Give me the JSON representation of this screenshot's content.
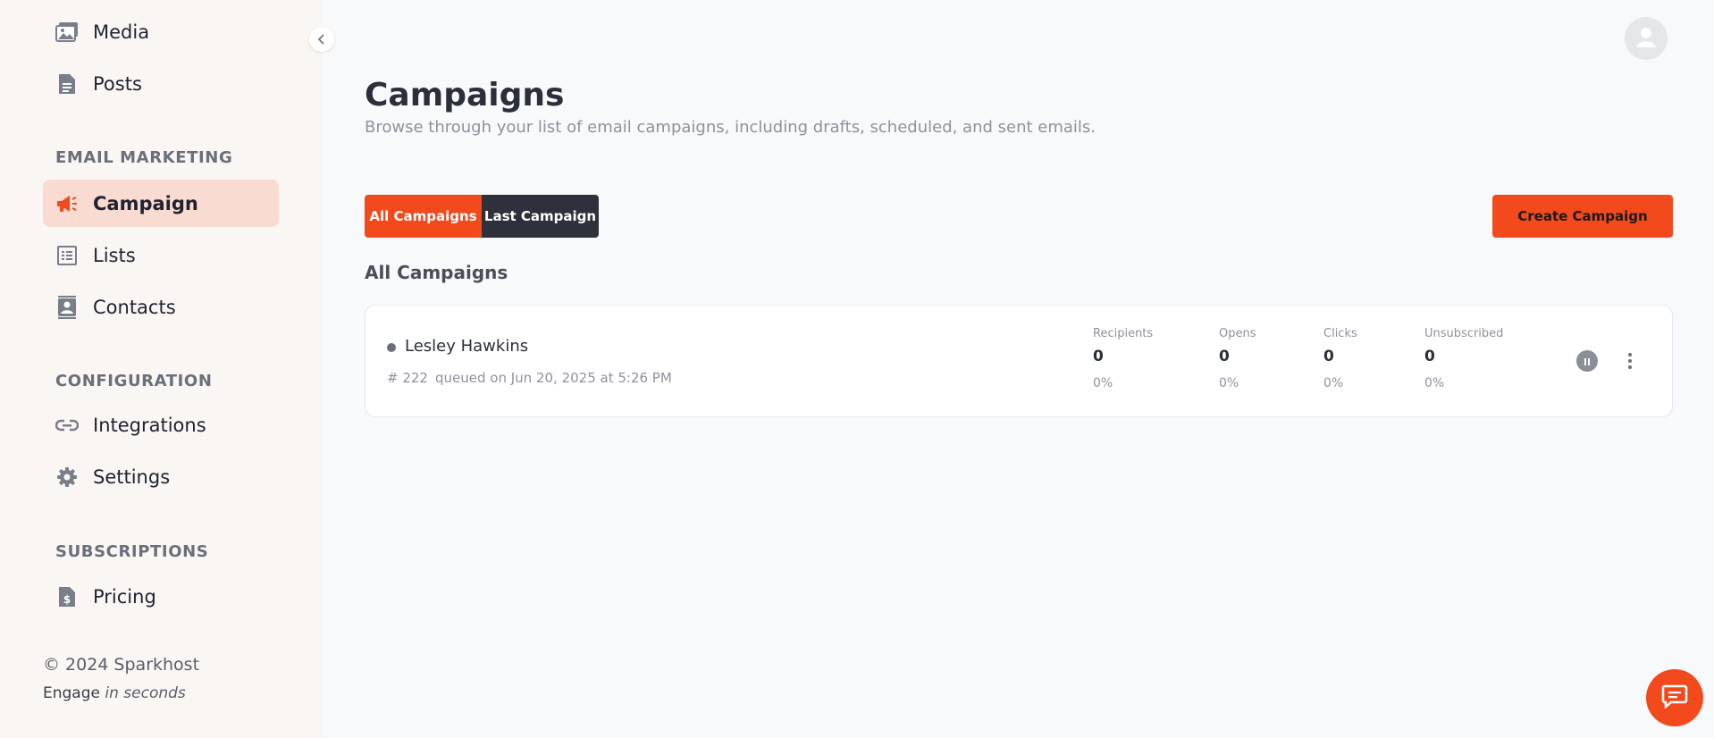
{
  "sidebar": {
    "items_top": [
      {
        "label": "Media",
        "icon": "image-icon"
      },
      {
        "label": "Posts",
        "icon": "document-icon"
      }
    ],
    "sections": {
      "email_marketing": "EMAIL MARKETING",
      "configuration": "CONFIGURATION",
      "subscriptions": "SUBSCRIPTIONS"
    },
    "email_items": [
      {
        "label": "Campaign",
        "icon": "megaphone-icon",
        "active": true
      },
      {
        "label": "Lists",
        "icon": "list-icon"
      },
      {
        "label": "Contacts",
        "icon": "contact-card-icon"
      }
    ],
    "config_items": [
      {
        "label": "Integrations",
        "icon": "link-icon"
      },
      {
        "label": "Settings",
        "icon": "gear-icon"
      }
    ],
    "subscription_items": [
      {
        "label": "Pricing",
        "icon": "invoice-icon"
      }
    ],
    "footer": {
      "copyright": "© 2024 Sparkhost",
      "tagline_prefix": "Engage",
      "tagline_emphasis": "in seconds"
    }
  },
  "header": {
    "title": "Campaigns",
    "subtitle": "Browse through your list of email campaigns, including drafts, scheduled, and sent emails."
  },
  "filters": {
    "all": "All Campaigns",
    "last": "Last Campaign"
  },
  "actions": {
    "create": "Create Campaign"
  },
  "list": {
    "heading": "All Campaigns",
    "campaigns": [
      {
        "name": "Lesley Hawkins",
        "id": "# 222",
        "meta": "queued on Jun 20, 2025 at 5:26 PM",
        "stats": [
          {
            "label": "Recipients",
            "value": "0",
            "pct": "0%"
          },
          {
            "label": "Opens",
            "value": "0",
            "pct": "0%"
          },
          {
            "label": "Clicks",
            "value": "0",
            "pct": "0%"
          },
          {
            "label": "Unsubscribed",
            "value": "0",
            "pct": "0%"
          }
        ]
      }
    ]
  },
  "colors": {
    "accent": "#f24a1c",
    "dark": "#2e313b",
    "active_bg": "#fadbd1",
    "sidebar_bg": "#faf6f3"
  }
}
